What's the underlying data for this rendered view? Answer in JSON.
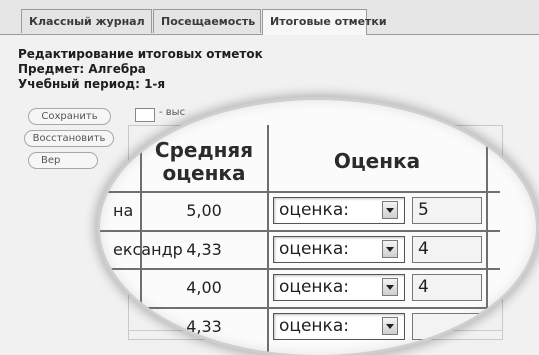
{
  "tabs": [
    {
      "label": "Классный журнал"
    },
    {
      "label": "Посещаемость"
    },
    {
      "label": "Итоговые отметки"
    }
  ],
  "header": {
    "title": "Редактирование итоговых отметок",
    "subject": "Предмет: Алгебра",
    "period": "Учебный период: 1-я"
  },
  "actions": {
    "save": "Сохранить",
    "restore": "Восстановить",
    "back": "Вер"
  },
  "legend": {
    "text": "- выс"
  },
  "table": {
    "columns": {
      "average": "Средняя оценка",
      "grade": "Оценка"
    },
    "rows": [
      {
        "name": "на",
        "average": "5,00",
        "select": "оценка:",
        "mark": "5"
      },
      {
        "name": "ександр",
        "average": "4,33",
        "select": "оценка:",
        "mark": "4"
      },
      {
        "name": "",
        "average": "4,00",
        "select": "оценка:",
        "mark": "4"
      },
      {
        "name": "",
        "average": "4,33",
        "select": "оценка:",
        "mark": ""
      }
    ]
  },
  "colors": {
    "grid": "#6f6f6f",
    "background": "#f1f1f1"
  }
}
